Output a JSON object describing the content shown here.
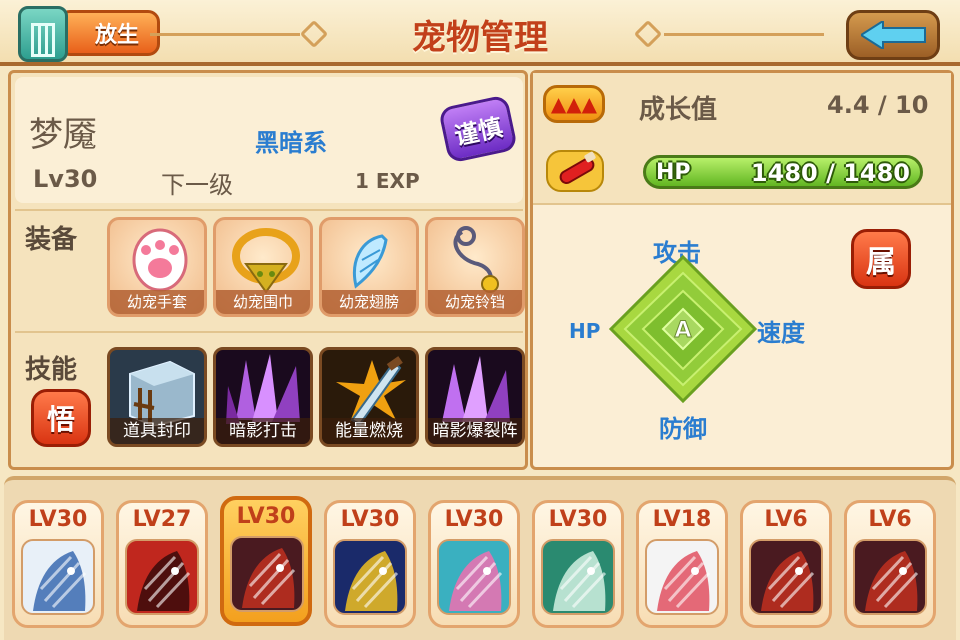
{
  "header": {
    "release_label": "放生",
    "title": "宠物管理"
  },
  "pet": {
    "name": "梦魇",
    "element": "黑暗系",
    "trait": "谨慎",
    "level": "Lv30",
    "next_level_label": "下一级",
    "exp_to_next": "1 EXP"
  },
  "equipment": {
    "label": "装备",
    "items": [
      {
        "name": "幼宠手套",
        "icon": "paw-glove-icon"
      },
      {
        "name": "幼宠围巾",
        "icon": "scarf-ring-icon"
      },
      {
        "name": "幼宠翅膀",
        "icon": "wing-icon"
      },
      {
        "name": "幼宠铃铛",
        "icon": "bell-necklace-icon"
      }
    ]
  },
  "skills": {
    "label": "技能",
    "enlighten_label": "悟",
    "items": [
      {
        "name": "道具封印",
        "icon": "cage-seal-icon"
      },
      {
        "name": "暗影打击",
        "icon": "shadow-crystal-icon"
      },
      {
        "name": "能量燃烧",
        "icon": "energy-sword-icon"
      },
      {
        "name": "暗影爆裂阵",
        "icon": "shadow-burst-icon"
      }
    ]
  },
  "stats": {
    "growth_label": "成长值",
    "growth_value": "4.4 / 10",
    "hp_label": "HP",
    "hp_value": "1480 / 1480",
    "hp_ratio": 1.0
  },
  "attributes": {
    "attack": "攻击",
    "speed": "速度",
    "hp": "HP",
    "defense": "防御",
    "grade": "A",
    "attr_button": "属"
  },
  "pet_list": [
    {
      "level": "LV30",
      "selected": false,
      "color": "#e8f0f8",
      "accent": "#3a6ab0"
    },
    {
      "level": "LV27",
      "selected": false,
      "color": "#c0271e",
      "accent": "#3a0a0a"
    },
    {
      "level": "LV30",
      "selected": true,
      "color": "#4a1a20",
      "accent": "#c03020"
    },
    {
      "level": "LV30",
      "selected": false,
      "color": "#1a2a6a",
      "accent": "#f0c020"
    },
    {
      "level": "LV30",
      "selected": false,
      "color": "#3ab0c0",
      "accent": "#f070b0"
    },
    {
      "level": "LV30",
      "selected": false,
      "color": "#2a8a70",
      "accent": "#d0f0e0"
    },
    {
      "level": "LV18",
      "selected": false,
      "color": "#f4f4f4",
      "accent": "#e05060"
    },
    {
      "level": "LV6",
      "selected": false,
      "color": "#4a1a20",
      "accent": "#c03020"
    },
    {
      "level": "LV6",
      "selected": false,
      "color": "#4a1a20",
      "accent": "#c03020"
    }
  ]
}
